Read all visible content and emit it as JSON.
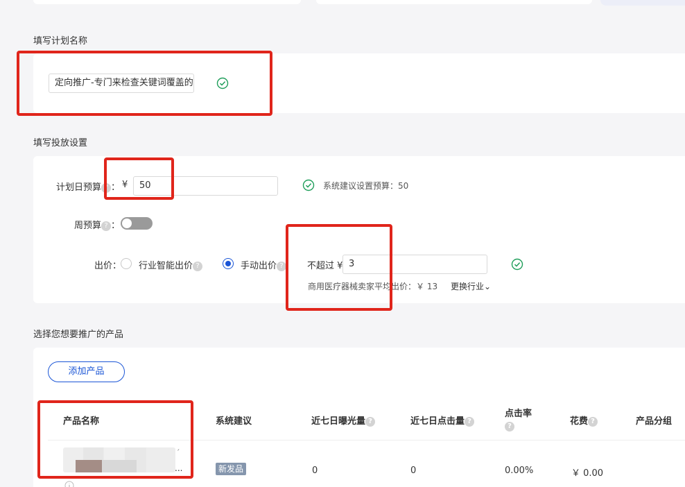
{
  "sections": {
    "plan_name_title": "填写计划名称",
    "delivery_title": "填写投放设置",
    "product_title": "选择您想要推广的产品"
  },
  "plan_name": {
    "value": "定向推广-专门来检查关键词覆盖的"
  },
  "budget": {
    "daily_label": "计划日预算",
    "colon": "：",
    "currency": "¥",
    "daily_value": "50",
    "suggest_text": "系统建议设置预算：50",
    "weekly_label": "周预算",
    "weekly_colon": "："
  },
  "bid": {
    "label": "出价：",
    "option_smart": "行业智能出价",
    "option_manual": "手动出价",
    "max_label": "不超过 ¥",
    "max_value": "3",
    "avg_text": "商用医疗器械卖家平均出价：￥ 13",
    "change_industry": "更换行业",
    "chevron": "⌄"
  },
  "products": {
    "add_button": "添加产品",
    "columns": [
      "产品名称",
      "系统建议",
      "近七日曝光量",
      "近七日点击量",
      "点击率",
      "花费",
      "产品分组"
    ],
    "row": {
      "ellipsis": "...",
      "tick": "´",
      "badge": "新发品",
      "exposure": "0",
      "clicks": "0",
      "ctr": "0.00%",
      "cost": "￥ 0.00"
    }
  },
  "colors": {
    "accent": "#1a55d6",
    "success": "#1f9e5a",
    "highlight": "#e0251b"
  }
}
